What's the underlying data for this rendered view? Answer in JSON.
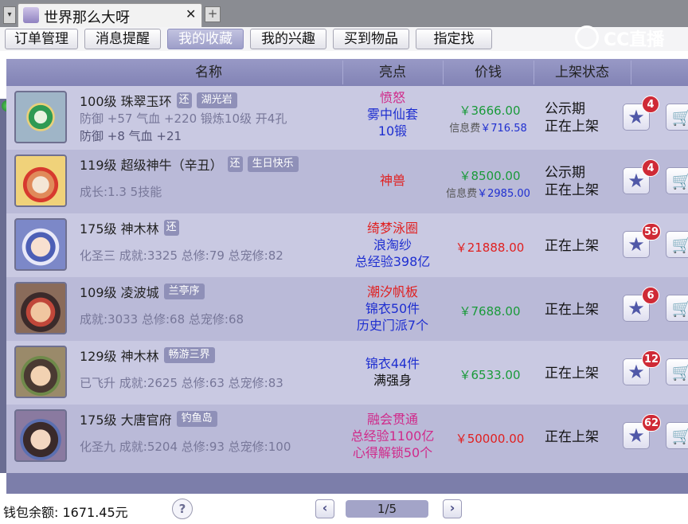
{
  "window": {
    "tab_title": "世界那么大呀",
    "tab_close": "✕",
    "tab_add": "+",
    "tab_arrow": "▾"
  },
  "nav": {
    "items": [
      "订单管理",
      "消息提醒",
      "我的收藏",
      "我的兴趣",
      "买到物品",
      "指定找"
    ],
    "active_index": 2
  },
  "logo": {
    "text": "CC直播"
  },
  "table": {
    "headers": [
      "名称",
      "亮点",
      "价钱",
      "上架状态"
    ]
  },
  "rows": [
    {
      "title": "100级  珠翠玉环",
      "tags": [
        "还",
        "湖光岩"
      ],
      "line2": "防御 +57  气血 +220  锻炼10级  开4孔",
      "line3": "防御 +8  气血 +21",
      "highlights": [
        {
          "text": "愤怒",
          "color": "pink"
        },
        {
          "text": "雾中仙套",
          "color": "blue"
        },
        {
          "text": "10锻",
          "color": "blue"
        }
      ],
      "price": "￥3666.00",
      "fee_label": "信息费",
      "fee_value": "￥716.58",
      "status": [
        "公示期",
        "正在上架"
      ],
      "badge": "4"
    },
    {
      "title": "119级  超级神牛（辛丑）",
      "tags": [
        "还",
        "生日快乐"
      ],
      "line2": "成长:1.3  5技能",
      "line3": "",
      "highlights": [
        {
          "text": "神兽",
          "color": "red"
        }
      ],
      "price": "￥8500.00",
      "fee_label": "信息费",
      "fee_value": "￥2985.00",
      "status": [
        "公示期",
        "正在上架"
      ],
      "badge": "4"
    },
    {
      "title": "175级  神木林",
      "tags": [
        "还"
      ],
      "line2": "化圣三  成就:3325  总修:79  总宠修:82",
      "line3": "",
      "highlights": [
        {
          "text": "绮梦泳圈",
          "color": "red"
        },
        {
          "text": "浪淘纱",
          "color": "blue"
        },
        {
          "text": "总经验398亿",
          "color": "blue"
        }
      ],
      "price": "￥21888.00",
      "fee_label": "",
      "fee_value": "",
      "status": [
        "正在上架"
      ],
      "badge": "59"
    },
    {
      "title": "109级  凌波城",
      "tags": [
        "兰亭序"
      ],
      "line2": "成就:3033  总修:68  总宠修:68",
      "line3": "",
      "highlights": [
        {
          "text": "潮汐帆板",
          "color": "red"
        },
        {
          "text": "锦衣50件",
          "color": "blue"
        },
        {
          "text": "历史门派7个",
          "color": "blue"
        }
      ],
      "price": "￥7688.00",
      "fee_label": "",
      "fee_value": "",
      "status": [
        "正在上架"
      ],
      "badge": "6"
    },
    {
      "title": "129级  神木林",
      "tags": [
        "畅游三界"
      ],
      "line2": "已飞升  成就:2625  总修:63  总宠修:83",
      "line3": "",
      "highlights": [
        {
          "text": "锦衣44件",
          "color": "blue"
        },
        {
          "text": "满强身",
          "color": "black"
        }
      ],
      "price": "￥6533.00",
      "fee_label": "",
      "fee_value": "",
      "status": [
        "正在上架"
      ],
      "badge": "12"
    },
    {
      "title": "175级  大唐官府",
      "tags": [
        "钓鱼岛"
      ],
      "line2": "化圣九  成就:5204  总修:93  总宠修:100",
      "line3": "",
      "highlights": [
        {
          "text": "融会贯通",
          "color": "pink"
        },
        {
          "text": "总经验1100亿",
          "color": "pink"
        },
        {
          "text": "心得解锁50个",
          "color": "pink"
        }
      ],
      "price": "￥50000.00",
      "fee_label": "",
      "fee_value": "",
      "status": [
        "正在上架"
      ],
      "badge": "62"
    }
  ],
  "footer": {
    "wallet": "钱包余额: 1671.45元",
    "help": "?",
    "prev": "‹",
    "next": "›",
    "page": "1/5"
  },
  "icons": {
    "star": "★",
    "cart": "🛒"
  },
  "colors": {
    "header": "#8a8bbd",
    "row_odd": "#c9c9e2",
    "row_even": "#babad8",
    "green_price": "#1a9a3a",
    "red_price": "#e02020",
    "badge": "#cf2a36"
  }
}
